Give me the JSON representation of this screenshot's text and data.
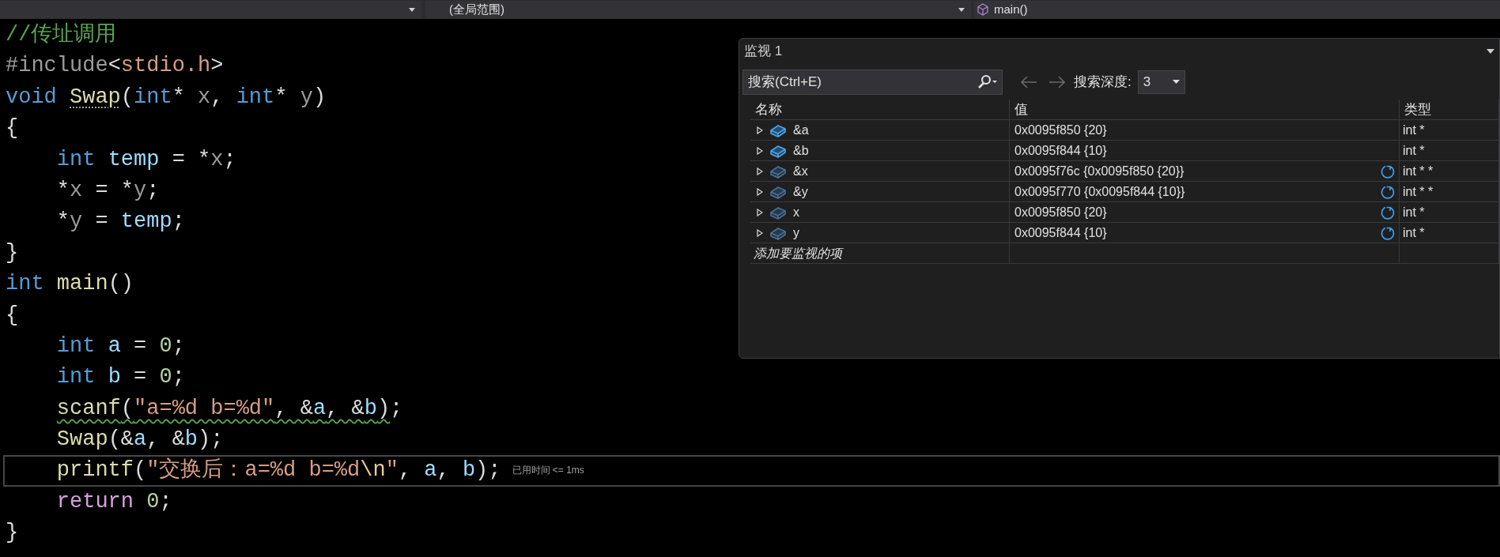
{
  "navigation_bar": {
    "scope": "(全局范围)",
    "member": "main()"
  },
  "code_lines": [
    {
      "current": false,
      "tokens": [
        {
          "kind": "comment",
          "t": "//传址调用"
        }
      ]
    },
    {
      "current": false,
      "tokens": [
        {
          "kind": "preproc",
          "t": "#include"
        },
        {
          "kind": "plain",
          "t": "<"
        },
        {
          "kind": "string",
          "t": "stdio.h"
        },
        {
          "kind": "plain",
          "t": ">"
        }
      ]
    },
    {
      "current": false,
      "tokens": [
        {
          "kind": "keyword",
          "t": "void "
        },
        {
          "kind": "func",
          "t": "Swap",
          "suggestion": true
        },
        {
          "kind": "plain",
          "t": "("
        },
        {
          "kind": "keyword",
          "t": "int"
        },
        {
          "kind": "plain",
          "t": "* "
        },
        {
          "kind": "param",
          "t": "x"
        },
        {
          "kind": "plain",
          "t": ", "
        },
        {
          "kind": "keyword",
          "t": "int"
        },
        {
          "kind": "plain",
          "t": "* "
        },
        {
          "kind": "param",
          "t": "y"
        },
        {
          "kind": "plain",
          "t": ")"
        }
      ]
    },
    {
      "current": false,
      "tokens": [
        {
          "kind": "plain",
          "t": "{"
        }
      ]
    },
    {
      "current": false,
      "tokens": [
        {
          "kind": "keyword",
          "t": "    int "
        },
        {
          "kind": "local",
          "t": "temp"
        },
        {
          "kind": "plain",
          "t": " = *"
        },
        {
          "kind": "param",
          "t": "x"
        },
        {
          "kind": "plain",
          "t": ";"
        }
      ]
    },
    {
      "current": false,
      "tokens": [
        {
          "kind": "plain",
          "t": "    *"
        },
        {
          "kind": "param",
          "t": "x"
        },
        {
          "kind": "plain",
          "t": " = *"
        },
        {
          "kind": "param",
          "t": "y"
        },
        {
          "kind": "plain",
          "t": ";"
        }
      ]
    },
    {
      "current": false,
      "tokens": [
        {
          "kind": "plain",
          "t": "    *"
        },
        {
          "kind": "param",
          "t": "y"
        },
        {
          "kind": "plain",
          "t": " = "
        },
        {
          "kind": "local",
          "t": "temp"
        },
        {
          "kind": "plain",
          "t": ";"
        }
      ]
    },
    {
      "current": false,
      "tokens": [
        {
          "kind": "plain",
          "t": "}"
        }
      ]
    },
    {
      "current": false,
      "tokens": [
        {
          "kind": "keyword",
          "t": "int "
        },
        {
          "kind": "func",
          "t": "main"
        },
        {
          "kind": "plain",
          "t": "()"
        }
      ]
    },
    {
      "current": false,
      "tokens": [
        {
          "kind": "plain",
          "t": "{"
        }
      ]
    },
    {
      "current": false,
      "tokens": [
        {
          "kind": "keyword",
          "t": "    int "
        },
        {
          "kind": "local",
          "t": "a"
        },
        {
          "kind": "plain",
          "t": " = "
        },
        {
          "kind": "number",
          "t": "0"
        },
        {
          "kind": "plain",
          "t": ";"
        }
      ]
    },
    {
      "current": false,
      "tokens": [
        {
          "kind": "keyword",
          "t": "    int "
        },
        {
          "kind": "local",
          "t": "b"
        },
        {
          "kind": "plain",
          "t": " = "
        },
        {
          "kind": "number",
          "t": "0"
        },
        {
          "kind": "plain",
          "t": ";"
        }
      ]
    },
    {
      "current": false,
      "tokens": [
        {
          "kind": "group",
          "warning": true,
          "tokens": [
            {
              "kind": "func",
              "t": "    scanf"
            },
            {
              "kind": "plain",
              "t": "("
            },
            {
              "kind": "string",
              "t": "\"a=%d b=%d\""
            },
            {
              "kind": "plain",
              "t": ", &"
            },
            {
              "kind": "local",
              "t": "a"
            },
            {
              "kind": "plain",
              "t": ", &"
            },
            {
              "kind": "local",
              "t": "b"
            },
            {
              "kind": "plain",
              "t": ")"
            }
          ]
        },
        {
          "kind": "plain",
          "t": ";"
        }
      ]
    },
    {
      "current": false,
      "tokens": [
        {
          "kind": "func",
          "t": "    Swap"
        },
        {
          "kind": "plain",
          "t": "(&"
        },
        {
          "kind": "local",
          "t": "a"
        },
        {
          "kind": "plain",
          "t": ", &"
        },
        {
          "kind": "local",
          "t": "b"
        },
        {
          "kind": "plain",
          "t": ");"
        }
      ]
    },
    {
      "current": true,
      "hint": "已用时间 <= 1ms",
      "tokens": [
        {
          "kind": "func",
          "t": "    printf"
        },
        {
          "kind": "plain",
          "t": "("
        },
        {
          "kind": "string",
          "t": "\"交换后：a=%d b=%d"
        },
        {
          "kind": "escape",
          "t": "\\n"
        },
        {
          "kind": "string",
          "t": "\""
        },
        {
          "kind": "plain",
          "t": ", "
        },
        {
          "kind": "local",
          "t": "a"
        },
        {
          "kind": "plain",
          "t": ", "
        },
        {
          "kind": "local",
          "t": "b"
        },
        {
          "kind": "plain",
          "t": ");"
        }
      ]
    },
    {
      "current": false,
      "tokens": [
        {
          "kind": "control",
          "t": "    return "
        },
        {
          "kind": "number",
          "t": "0"
        },
        {
          "kind": "plain",
          "t": ";"
        }
      ]
    },
    {
      "current": false,
      "tokens": [
        {
          "kind": "plain",
          "t": "}"
        }
      ]
    }
  ],
  "watch": {
    "title": "监视 1",
    "search": {
      "placeholder": "搜索(Ctrl+E)"
    },
    "depth_label": "搜索深度:",
    "depth": "3",
    "columns": [
      "名称",
      "值",
      "类型"
    ],
    "rows": [
      {
        "name": "&a",
        "value": "0x0095f850 {20}",
        "type": "int *",
        "stale": false
      },
      {
        "name": "&b",
        "value": "0x0095f844 {10}",
        "type": "int *",
        "stale": false
      },
      {
        "name": "&x",
        "value": "0x0095f76c {0x0095f850 {20}}",
        "type": "int * *",
        "stale": true
      },
      {
        "name": "&y",
        "value": "0x0095f770 {0x0095f844 {10}}",
        "type": "int * *",
        "stale": true
      },
      {
        "name": "x",
        "value": "0x0095f850 {20}",
        "type": "int *",
        "stale": true
      },
      {
        "name": "y",
        "value": "0x0095f844 {10}",
        "type": "int *",
        "stale": true
      }
    ],
    "add_placeholder": "添加要监视的项"
  }
}
